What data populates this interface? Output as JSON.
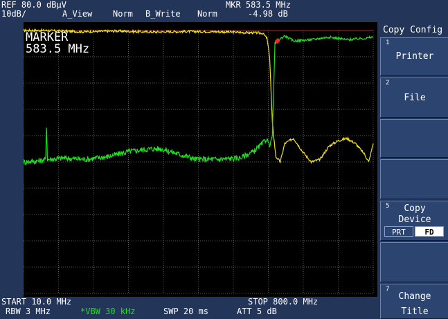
{
  "header": {
    "ref_level": "REF 80.0 dBµV",
    "scale": "10dB/",
    "trace_a": "A_View",
    "trace_a_det": "Norm",
    "trace_b": "B_Write",
    "trace_b_det": "Norm",
    "mkr_freq": "MKR 583.5 MHz",
    "mkr_level": "-4.98 dB"
  },
  "marker": {
    "label": "MARKER",
    "freq": "583.5 MHz"
  },
  "softkeys": {
    "menu_title": "Copy Config",
    "keys": [
      {
        "num": "1",
        "line1": "Printer",
        "line2": ""
      },
      {
        "num": "2",
        "line1": "File",
        "line2": ""
      },
      {
        "num": "5",
        "line1": "Copy",
        "line2": "Device",
        "opt_a": "PRT",
        "opt_b": "FD",
        "selected": "FD"
      },
      {
        "num": "7",
        "line1": "Change",
        "line2": "Title"
      }
    ]
  },
  "footer": {
    "start": "START 10.0 MHz",
    "stop": "STOP 800.0 MHz",
    "rbw": "RBW 3 MHz",
    "vbw": "*VBW 30 kHz",
    "swp": "SWP 20 ms",
    "att": "ATT 5 dB"
  },
  "colors": {
    "background": "#23365a",
    "trace_yellow": "#f0e020",
    "trace_green": "#22dd22",
    "marker": "#ff2020",
    "vbw_text": "#22dd22",
    "ref_line": "#c02020"
  },
  "chart_data": {
    "type": "line",
    "x_start_mhz": 10.0,
    "x_stop_mhz": 800.0,
    "ref_level_dbuv": 80.0,
    "db_per_div": 10,
    "divisions_y": 10,
    "divisions_x": 10,
    "grid": true,
    "marker": {
      "x_mhz": 583.5,
      "y_dbuv": 76.0
    },
    "series": [
      {
        "color": "yellow",
        "x_mhz": [
          10,
          60,
          140,
          220,
          300,
          380,
          460,
          510,
          550,
          560,
          566,
          572,
          580,
          590,
          600,
          620,
          640,
          660,
          680,
          700,
          720,
          740,
          760,
          780,
          790,
          800
        ],
        "y_dbuv": [
          80,
          80,
          79.5,
          79.8,
          79.4,
          79.6,
          79.5,
          79.2,
          79,
          77,
          70,
          45,
          32,
          30,
          37,
          39,
          34,
          30,
          31,
          36,
          38,
          39,
          37,
          33,
          30,
          37
        ]
      },
      {
        "color": "green",
        "x_mhz": [
          10,
          50,
          60,
          62,
          64,
          70,
          100,
          150,
          200,
          250,
          300,
          320,
          350,
          400,
          450,
          500,
          530,
          550,
          560,
          566,
          572,
          578,
          583.5,
          600,
          620,
          660,
          700,
          740,
          780,
          800
        ],
        "y_dbuv": [
          30,
          30.5,
          31,
          44,
          31,
          31,
          31.5,
          31,
          32,
          34,
          35,
          35,
          33.5,
          31,
          31,
          31.5,
          34,
          37,
          39,
          36,
          40,
          75,
          76,
          78,
          76,
          76.5,
          77.5,
          76.5,
          77,
          77.5
        ]
      }
    ]
  }
}
